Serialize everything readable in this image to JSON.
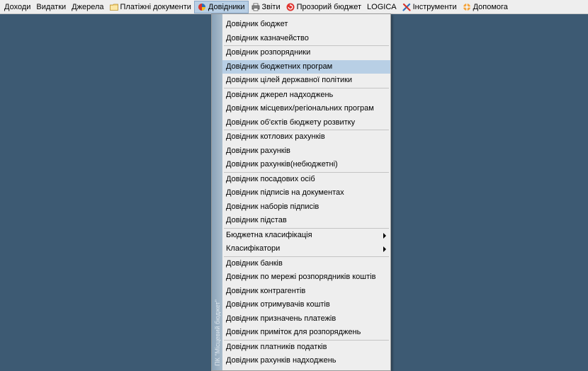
{
  "menubar": {
    "items": [
      {
        "label": "Доходи"
      },
      {
        "label": "Видатки"
      },
      {
        "label": "Джерела"
      },
      {
        "label": "Платіжні документи",
        "icon": "folder-icon"
      },
      {
        "label": "Довідники",
        "icon": "book-icon"
      },
      {
        "label": "Звіти",
        "icon": "printer-icon"
      },
      {
        "label": "Прозорий бюджет",
        "icon": "refresh-icon"
      },
      {
        "label": "LOGICA"
      },
      {
        "label": "Інструменти",
        "icon": "tools-icon"
      },
      {
        "label": "Допомога",
        "icon": "lifebuoy-icon"
      }
    ]
  },
  "dropdown": {
    "side_label": "ПК \"Місцевий бюджет\"",
    "groups": [
      [
        "Довідник бюджет",
        "Довідник казначейство"
      ],
      [
        "Довідник розпорядники",
        "Довідник бюджетних програм",
        "Довідник цілей державної політики"
      ],
      [
        "Довідник джерел надходжень",
        "Довідник місцевих/регіональних програм",
        "Довідник об'єктів бюджету розвитку"
      ],
      [
        "Довідник котлових рахунків",
        "Довідник рахунків",
        "Довідник рахунків(небюджетні)"
      ],
      [
        "Довідник посадових осіб",
        "Довідник підписів на документах",
        "Довідник наборів підписів",
        "Довідник підстав"
      ],
      [
        "Бюджетна класифікація",
        "Класифікатори"
      ],
      [
        "Довідник банків",
        "Довідник по мережі розпорядників коштів",
        "Довідник контрагентів",
        "Довідник отримувачів коштів",
        "Довідник призначень платежів",
        "Довідник приміток для розпоряджень"
      ],
      [
        "Довідник платників податків",
        "Довідник рахунків надходжень"
      ]
    ],
    "highlighted_item": "Довідник бюджетних програм",
    "submenu_items": [
      "Бюджетна класифікація",
      "Класифікатори"
    ]
  },
  "colors": {
    "desktop": "#3d5a73",
    "menubar": "#eeeeee",
    "highlight": "#b8cfe5"
  }
}
